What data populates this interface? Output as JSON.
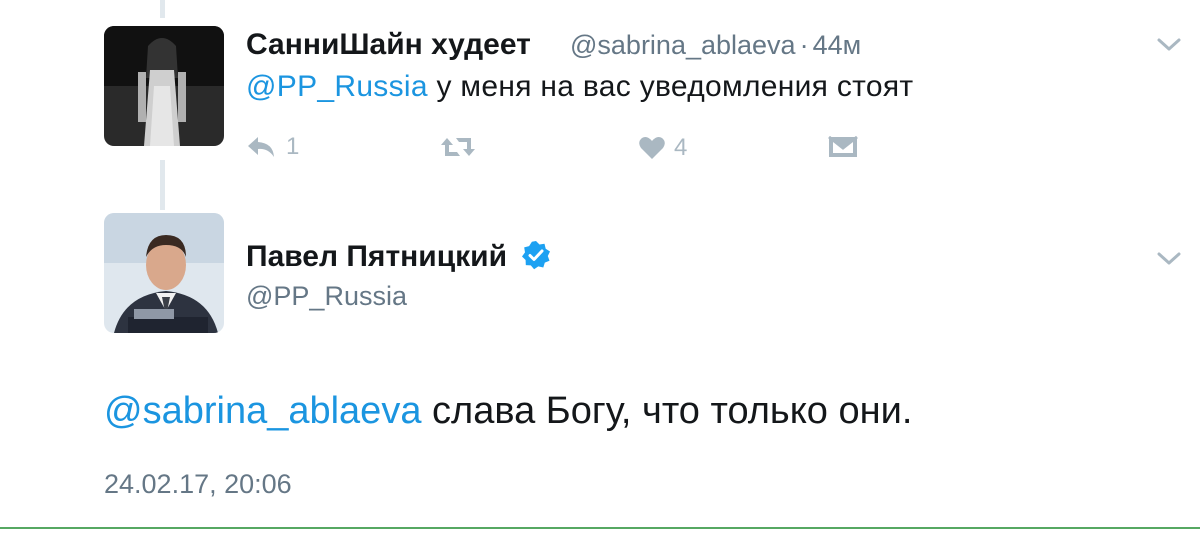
{
  "reply_tweet": {
    "display_name": "СанниШайн худеет",
    "handle": "@sabrina_ablaeva",
    "separator": "·",
    "time_ago": "44м",
    "mention": "@PP_Russia",
    "text": "у меня на вас уведомления стоят",
    "actions": {
      "reply_icon": "reply-icon",
      "reply_count": "1",
      "retweet_icon": "retweet-icon",
      "like_icon": "heart-icon",
      "like_count": "4",
      "dm_icon": "envelope-icon"
    }
  },
  "main_tweet": {
    "display_name": "Павел Пятницкий",
    "verified_icon": "verified-badge-icon",
    "handle": "@PP_Russia",
    "mention": "@sabrina_ablaeva",
    "text": "слава Богу, что только они.",
    "timestamp": "24.02.17, 20:06"
  },
  "colors": {
    "link": "#1b95e0",
    "muted": "#657786",
    "icon": "#aab8c2",
    "thread_line": "#e1e8ed",
    "verified": "#1da1f2"
  }
}
